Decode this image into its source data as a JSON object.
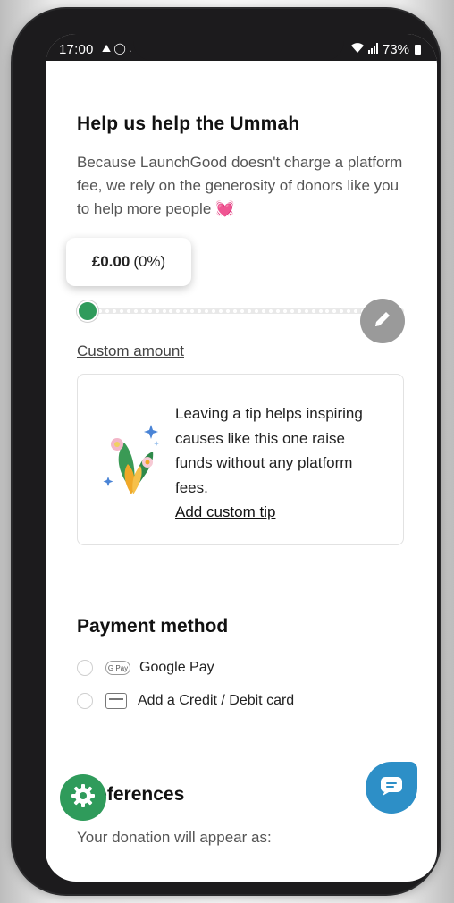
{
  "status_bar": {
    "time": "17:00",
    "left_icons": "⛰ ◯ .",
    "battery": "73%"
  },
  "tip_section": {
    "title": "Help us help the Ummah",
    "description": "Because LaunchGood doesn't charge a platform fee, we rely on the generosity of donors like you to help more people",
    "heart": "💓",
    "tip_amount": "£0.00",
    "tip_percent": "(0%)",
    "slider_value": 0,
    "custom_amount_link": "Custom amount"
  },
  "tip_card": {
    "text": "Leaving a tip helps inspiring causes like this one raise funds without any platform fees.",
    "link": "Add custom tip"
  },
  "payment": {
    "title": "Payment method",
    "options": [
      {
        "icon": "google-pay-icon",
        "badge": "G Pay",
        "label": "Google Pay"
      },
      {
        "icon": "credit-card-icon",
        "label": "Add a Credit / Debit card"
      }
    ]
  },
  "preferences": {
    "title": "Preferences",
    "subtitle": "Your donation will appear as:"
  },
  "colors": {
    "accent_green": "#2f9b5b",
    "chat_blue": "#2d8fc7",
    "edit_gray": "#9a9a9a"
  }
}
